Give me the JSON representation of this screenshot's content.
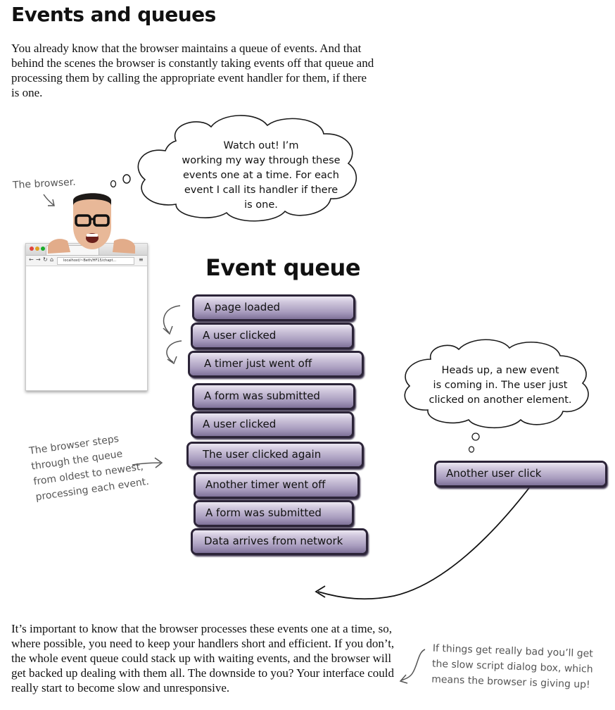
{
  "page": {
    "title": "Events and queues",
    "intro": "You already know that the browser maintains a queue of events. And that behind the scenes the browser is constantly taking events off that queue and processing them by calling the appropriate event handler for them, if there is one.",
    "bottom_text": "It’s important to know that the browser processes these events one at a time, so, where possible, you need to keep your handlers short and efficient. If you don’t, the whole event queue could stack up with waiting events, and the browser will get backed up dealing with them all. The downside to you? Your interface could really start to become slow and unresponsive."
  },
  "browser_label": "The browser.",
  "browser_bubble": {
    "lines": [
      "Watch out! I’m",
      "working my way through these",
      "events one at a time. For each",
      "event I call its handler if there",
      "is one."
    ]
  },
  "browser_window": {
    "url": "localhost/~Beth/HF15/chapt..."
  },
  "queue": {
    "heading": "Event queue",
    "items": [
      "A page loaded",
      "A user clicked",
      "A timer just went off",
      "A form was submitted",
      "A user clicked",
      "The user clicked again",
      "Another timer went off",
      "A form was submitted",
      "Data arrives from network"
    ]
  },
  "steps_note": {
    "lines": [
      "The browser steps",
      "through the queue",
      "from oldest to newest,",
      "processing each event."
    ]
  },
  "new_event_bubble": {
    "lines": [
      "Heads up, a new event",
      "is coming in. The user just",
      "clicked on another element."
    ]
  },
  "new_event": "Another user click",
  "slow_note": {
    "lines": [
      "If things get really bad you’ll get",
      "the slow script dialog box, which",
      "means the browser is giving up!"
    ]
  },
  "colors": {
    "bar_top": "#ece8f2",
    "bar_bottom": "#7f7299",
    "bar_outline": "#2c2438",
    "handwriting": "#555555"
  }
}
